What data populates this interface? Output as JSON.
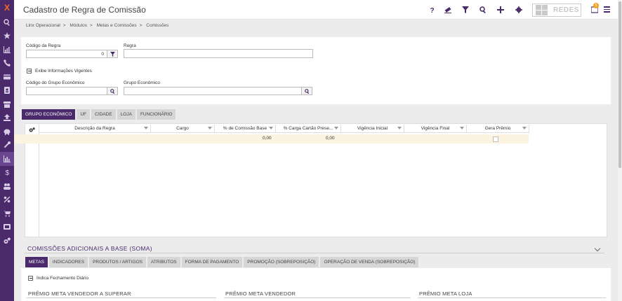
{
  "sidebar": {
    "logo": "X",
    "items": [
      "search",
      "star",
      "chart",
      "phone",
      "card",
      "contacts",
      "store",
      "upload",
      "piggy",
      "tools",
      "report",
      "dollar",
      "users",
      "percent",
      "cart",
      "media",
      "settings"
    ],
    "active_index": 10
  },
  "header": {
    "title": "Cadastro de Regra de Comissão",
    "redes_label": "REDES",
    "notification_count": "5",
    "icons": [
      "help-icon",
      "eraser-icon",
      "filter-icon",
      "search-icon",
      "plus-icon",
      "gear-icon"
    ]
  },
  "breadcrumb": [
    "Linx Operacional",
    "Módulos",
    "Metas e Comissões",
    "Comissões"
  ],
  "filters": {
    "codigo_regra_label": "Código da Regra",
    "codigo_regra_value": "0",
    "regra_label": "Regra",
    "regra_value": "",
    "exibe_label": "Exibe Informações Vigentes",
    "codigo_grupo_label": "Código do Grupo Econômico",
    "codigo_grupo_value": "",
    "grupo_label": "Grupo Econômico",
    "grupo_value": ""
  },
  "tabs": [
    "GRUPO ECONÔMICO",
    "UF",
    "CIDADE",
    "LOJA",
    "FUNCIONÁRIO"
  ],
  "grid": {
    "columns": [
      "Descrição da Regra",
      "Cargo",
      "% de Comissão Base",
      "% Carga Cartão Prese...",
      "Vigência Inicial",
      "Vigência Final",
      "Gera Prêmio"
    ],
    "row": [
      "",
      "",
      "0,00",
      "0,00",
      "",
      "",
      ""
    ]
  },
  "section2": {
    "title": "COMISSÕES ADICIONAIS A BASE (SOMA)",
    "tabs": [
      "METAS",
      "INDICADORES",
      "PRODUTOS / ARTIGOS",
      "ATRIBUTOS",
      "FORMA DE PAGAMENTO",
      "PROMOÇÃO (SOBREPOSIÇÃO)",
      "OPERAÇÃO DE VENDA (SOBREPOSIÇÃO)"
    ],
    "indica_label": "Indica Fechamento Diário",
    "subheads": [
      "PRÊMIO META VENDEDOR A SUPERAR",
      "PRÊMIO META VENDEDOR",
      "PRÊMIO META LOJA"
    ]
  },
  "colors": {
    "brand": "#4a2a6b",
    "accent": "#f26d21",
    "row_highlight": "#fcf3e0"
  }
}
